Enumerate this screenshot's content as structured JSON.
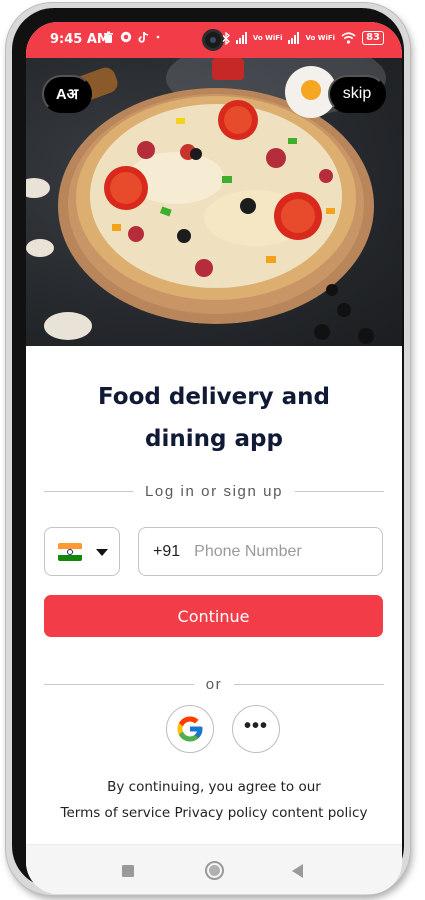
{
  "status_bar": {
    "time": "9:45 AM",
    "left_icons": [
      "trash-icon",
      "chat-bubble-icon",
      "tiktok-icon",
      "dot-icon"
    ],
    "right_icons": [
      "bluetooth-icon",
      "signal-icon",
      "vowifi-icon",
      "signal-icon",
      "vowifi-icon",
      "wifi-icon"
    ],
    "vowifi_label": "Vo WiFi",
    "battery": "83"
  },
  "hero": {
    "language_button_label": "Aअ",
    "skip_label": "skip"
  },
  "headline": "Food delivery and dining app",
  "auth": {
    "divider_label": "Log in or sign up",
    "country_code": "+91",
    "phone_placeholder": "Phone Number",
    "phone_value": "",
    "continue_label": "Continue",
    "or_label": "or",
    "more_label": "•••"
  },
  "terms": {
    "line1": "By continuing, you agree to our",
    "terms_of_service": "Terms of service",
    "privacy_policy": "Privacy policy",
    "content_policy": "content policy"
  },
  "colors": {
    "accent": "#f23c48",
    "headline": "#101935"
  }
}
